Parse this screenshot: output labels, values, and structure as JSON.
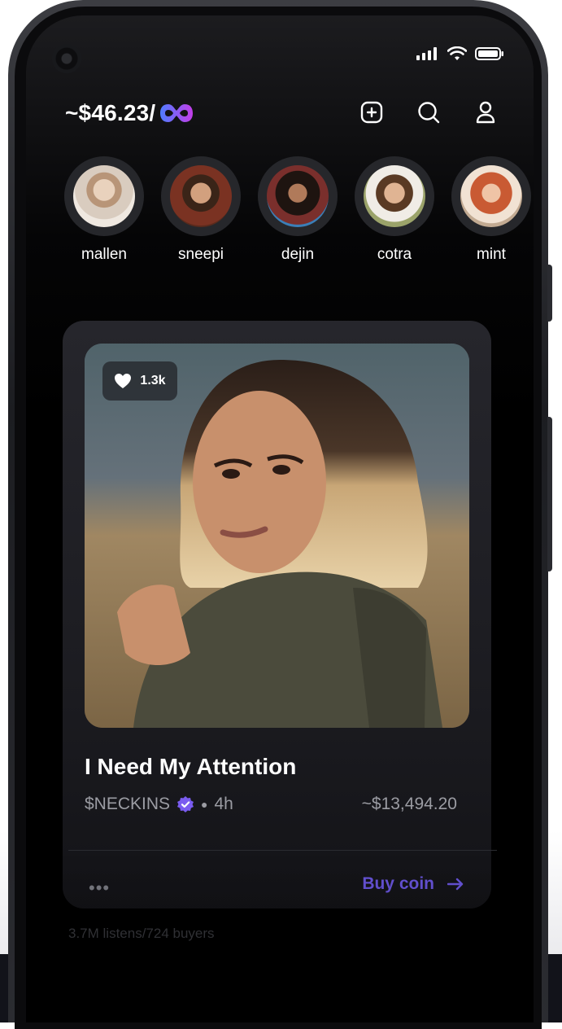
{
  "header": {
    "balance": "~$46.23/",
    "logo_icon": "infinity-logo-icon",
    "actions": [
      "add-post-icon",
      "search-icon",
      "profile-icon"
    ]
  },
  "status_bar": {
    "icons": [
      "signal-icon",
      "wifi-icon",
      "battery-icon"
    ]
  },
  "stories": [
    {
      "name": "mallen"
    },
    {
      "name": "sneepi"
    },
    {
      "name": "dejin"
    },
    {
      "name": "cotra"
    },
    {
      "name": "mint"
    }
  ],
  "post": {
    "likes": "1.3k",
    "title": "I Need My Attention",
    "coin": "$NECKINS",
    "age": "4h",
    "price": "~$13,494.20",
    "more": "•••",
    "buy_label": "Buy coin"
  },
  "stats": "3.7M listens/724 buyers",
  "colors": {
    "accent": "#6a56e0",
    "logo_gradient": [
      "#4f7cff",
      "#c33ee8"
    ]
  }
}
